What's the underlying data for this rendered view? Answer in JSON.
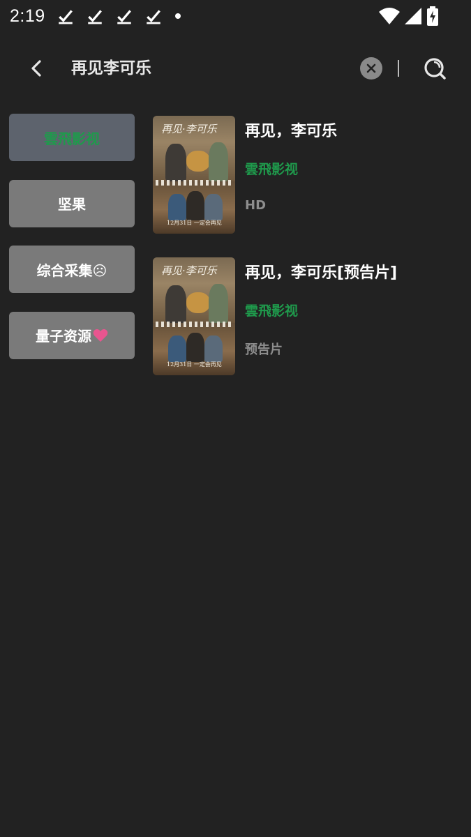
{
  "status_bar": {
    "time": "2:19",
    "notification_icons": [
      "download-done-icon",
      "download-done-icon",
      "download-done-icon",
      "download-done-icon"
    ],
    "right_icons": [
      "wifi-icon",
      "cell-signal-icon",
      "battery-charging-icon"
    ]
  },
  "search": {
    "query": "再见李可乐"
  },
  "sources": [
    {
      "label": "雲飛影视",
      "active": true
    },
    {
      "label": "坚果",
      "active": false
    },
    {
      "label": "综合采集☹",
      "active": false
    },
    {
      "label": "量子资源",
      "suffix_icon": "heart-icon",
      "active": false
    }
  ],
  "results": [
    {
      "title": "再见，李可乐",
      "source": "雲飛影视",
      "note": "HD",
      "poster": {
        "title": "再见·李可乐",
        "caption": "12月31日 一定会再见"
      }
    },
    {
      "title": "再见，李可乐[预告片]",
      "source": "雲飛影视",
      "note": "预告片",
      "poster": {
        "title": "再见·李可乐",
        "caption": "12月31日 一定会再见"
      }
    }
  ],
  "colors": {
    "background": "#222222",
    "accent_green": "#1f9a4c",
    "heart": "#e8558f",
    "source_inactive": "#7a7a7a",
    "source_active": "#5d636d"
  }
}
